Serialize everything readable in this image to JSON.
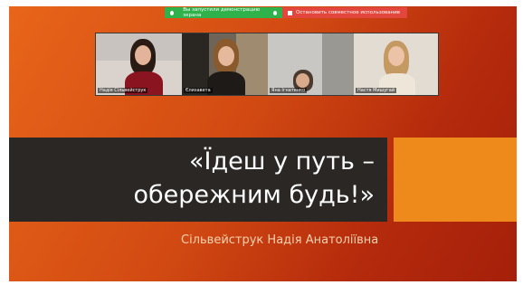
{
  "share_bar": {
    "status_text": "Вы запустили демонстрацию экрана",
    "stop_label": "Остановить совместное использование"
  },
  "participants": [
    {
      "name": "Надія Сільвейструк"
    },
    {
      "name": "Єлизавета"
    },
    {
      "name": "Яна Ігнатенко"
    },
    {
      "name": "Настя Мишугай"
    }
  ],
  "slide": {
    "title_line1": "«Їдеш у путь –",
    "title_line2": "обережним будь!»",
    "author": "Сільвейструк Надія Анатоліївна"
  },
  "colors": {
    "slide_orange": "#d24a12",
    "title_bar": "#2b2725",
    "accent": "#ee8a1c",
    "share_green": "#2fb24c",
    "share_red": "#e3463d"
  }
}
